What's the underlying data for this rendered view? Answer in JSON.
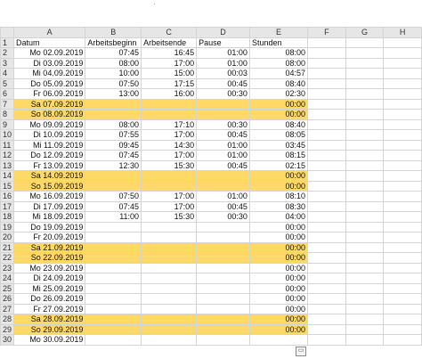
{
  "columns": [
    "A",
    "B",
    "C",
    "D",
    "E",
    "F",
    "G",
    "H"
  ],
  "header_row": {
    "num": "1",
    "cells": [
      "Datum",
      "Arbeitsbeginn",
      "Arbeitsende",
      "Pause",
      "Stunden",
      "",
      "",
      ""
    ]
  },
  "rows": [
    {
      "num": "2",
      "date": "Mo 02.09.2019",
      "start": "07:45",
      "end": "16:45",
      "pause": "01:00",
      "hours": "08:00",
      "highlight": false
    },
    {
      "num": "3",
      "date": "Di 03.09.2019",
      "start": "08:00",
      "end": "17:00",
      "pause": "01:00",
      "hours": "08:00",
      "highlight": false
    },
    {
      "num": "4",
      "date": "Mi 04.09.2019",
      "start": "10:00",
      "end": "15:00",
      "pause": "00:03",
      "hours": "04:57",
      "highlight": false
    },
    {
      "num": "5",
      "date": "Do 05.09.2019",
      "start": "07:50",
      "end": "17:15",
      "pause": "00:45",
      "hours": "08:40",
      "highlight": false
    },
    {
      "num": "6",
      "date": "Fr 06.09.2019",
      "start": "13:00",
      "end": "16:00",
      "pause": "00:30",
      "hours": "02:30",
      "highlight": false
    },
    {
      "num": "7",
      "date": "Sa 07.09.2019",
      "start": "",
      "end": "",
      "pause": "",
      "hours": "00:00",
      "highlight": true
    },
    {
      "num": "8",
      "date": "So 08.09.2019",
      "start": "",
      "end": "",
      "pause": "",
      "hours": "00:00",
      "highlight": true
    },
    {
      "num": "9",
      "date": "Mo 09.09.2019",
      "start": "08:00",
      "end": "17:10",
      "pause": "00:30",
      "hours": "08:40",
      "highlight": false
    },
    {
      "num": "10",
      "date": "Di 10.09.2019",
      "start": "07:55",
      "end": "17:00",
      "pause": "00:45",
      "hours": "08:05",
      "highlight": false
    },
    {
      "num": "11",
      "date": "Mi 11.09.2019",
      "start": "09:45",
      "end": "14:30",
      "pause": "01:00",
      "hours": "03:45",
      "highlight": false
    },
    {
      "num": "12",
      "date": "Do 12.09.2019",
      "start": "07:45",
      "end": "17:00",
      "pause": "01:00",
      "hours": "08:15",
      "highlight": false
    },
    {
      "num": "13",
      "date": "Fr 13.09.2019",
      "start": "12:30",
      "end": "15:30",
      "pause": "00:45",
      "hours": "02:15",
      "highlight": false
    },
    {
      "num": "14",
      "date": "Sa 14.09.2019",
      "start": "",
      "end": "",
      "pause": "",
      "hours": "00:00",
      "highlight": true
    },
    {
      "num": "15",
      "date": "So 15.09.2019",
      "start": "",
      "end": "",
      "pause": "",
      "hours": "00:00",
      "highlight": true
    },
    {
      "num": "16",
      "date": "Mo 16.09.2019",
      "start": "07:50",
      "end": "17:00",
      "pause": "01:00",
      "hours": "08:10",
      "highlight": false
    },
    {
      "num": "17",
      "date": "Di 17.09.2019",
      "start": "07:45",
      "end": "17:00",
      "pause": "00:45",
      "hours": "08:30",
      "highlight": false
    },
    {
      "num": "18",
      "date": "Mi 18.09.2019",
      "start": "11:00",
      "end": "15:30",
      "pause": "00:30",
      "hours": "04:00",
      "highlight": false
    },
    {
      "num": "19",
      "date": "Do 19.09.2019",
      "start": "",
      "end": "",
      "pause": "",
      "hours": "00:00",
      "highlight": false
    },
    {
      "num": "20",
      "date": "Fr 20.09.2019",
      "start": "",
      "end": "",
      "pause": "",
      "hours": "00:00",
      "highlight": false
    },
    {
      "num": "21",
      "date": "Sa 21.09.2019",
      "start": "",
      "end": "",
      "pause": "",
      "hours": "00:00",
      "highlight": true
    },
    {
      "num": "22",
      "date": "So 22.09.2019",
      "start": "",
      "end": "",
      "pause": "",
      "hours": "00:00",
      "highlight": true
    },
    {
      "num": "23",
      "date": "Mo 23.09.2019",
      "start": "",
      "end": "",
      "pause": "",
      "hours": "00:00",
      "highlight": false
    },
    {
      "num": "24",
      "date": "Di 24.09.2019",
      "start": "",
      "end": "",
      "pause": "",
      "hours": "00:00",
      "highlight": false
    },
    {
      "num": "25",
      "date": "Mi 25.09.2019",
      "start": "",
      "end": "",
      "pause": "",
      "hours": "00:00",
      "highlight": false
    },
    {
      "num": "26",
      "date": "Do 26.09.2019",
      "start": "",
      "end": "",
      "pause": "",
      "hours": "00:00",
      "highlight": false
    },
    {
      "num": "27",
      "date": "Fr 27.09.2019",
      "start": "",
      "end": "",
      "pause": "",
      "hours": "00:00",
      "highlight": false
    },
    {
      "num": "28",
      "date": "Sa 28.09.2019",
      "start": "",
      "end": "",
      "pause": "",
      "hours": "00:00",
      "highlight": true
    },
    {
      "num": "29",
      "date": "So 29.09.2019",
      "start": "",
      "end": "",
      "pause": "",
      "hours": "00:00",
      "highlight": true
    },
    {
      "num": "30",
      "date": "Mo 30.09.2019",
      "start": "",
      "end": "",
      "pause": "",
      "hours": "",
      "highlight": false
    }
  ],
  "colors": {
    "highlight": "#ffd966",
    "header_bg": "#e6e6e6",
    "grid": "#d4d4d4"
  },
  "icons": {
    "paste_options": "paste-options-icon"
  }
}
